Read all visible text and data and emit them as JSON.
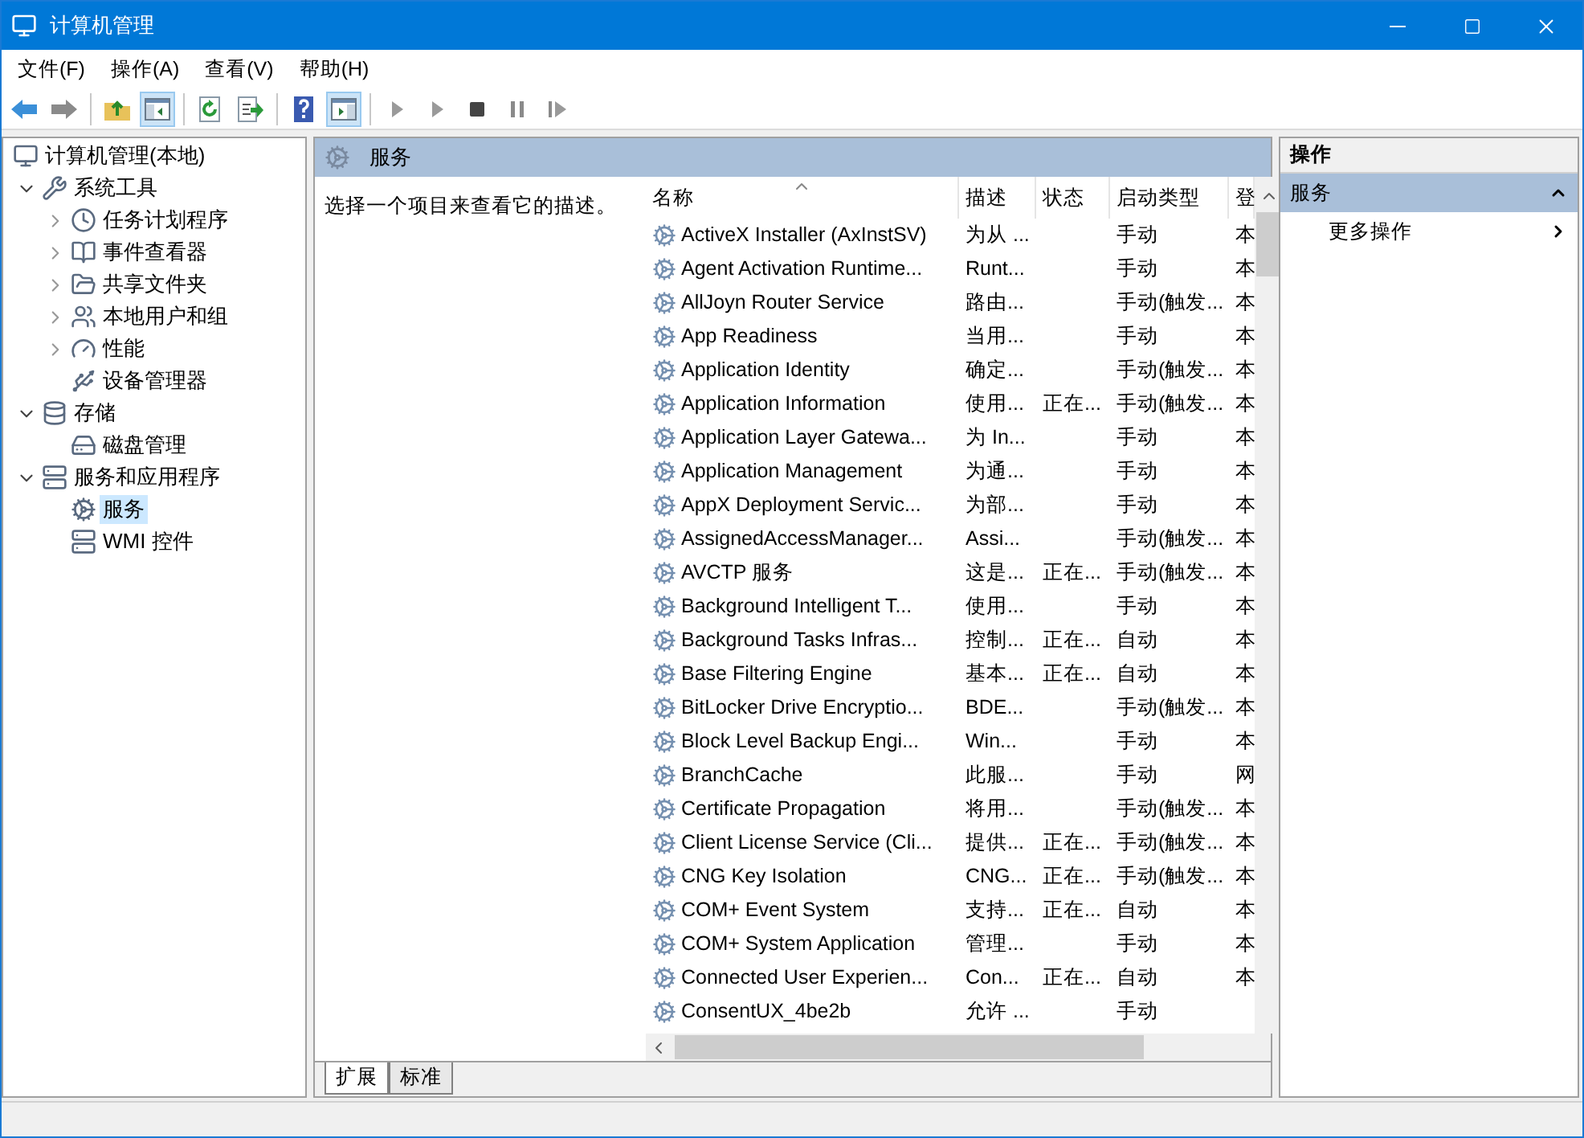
{
  "window": {
    "title": "计算机管理"
  },
  "menu": [
    "文件(F)",
    "操作(A)",
    "查看(V)",
    "帮助(H)"
  ],
  "toolbar": [
    {
      "kind": "back",
      "pressed": false
    },
    {
      "kind": "forward",
      "pressed": false
    },
    {
      "kind": "separator"
    },
    {
      "kind": "up",
      "pressed": false
    },
    {
      "kind": "tree-pane",
      "pressed": true
    },
    {
      "kind": "separator"
    },
    {
      "kind": "refresh",
      "pressed": false
    },
    {
      "kind": "export",
      "pressed": false
    },
    {
      "kind": "separator"
    },
    {
      "kind": "help",
      "pressed": false
    },
    {
      "kind": "action-pane",
      "pressed": true
    },
    {
      "kind": "separator"
    },
    {
      "kind": "play",
      "pressed": false
    },
    {
      "kind": "play",
      "pressed": false
    },
    {
      "kind": "stop",
      "pressed": false
    },
    {
      "kind": "pause",
      "pressed": false
    },
    {
      "kind": "resume",
      "pressed": false
    }
  ],
  "tree": [
    {
      "label": "计算机管理(本地)",
      "selected": false,
      "children": [
        {
          "label": "系统工具",
          "selected": false,
          "expanded": true,
          "children": [
            {
              "label": "任务计划程序",
              "selected": false,
              "expanded": false
            },
            {
              "label": "事件查看器",
              "selected": false,
              "expanded": false
            },
            {
              "label": "共享文件夹",
              "selected": false,
              "expanded": false
            },
            {
              "label": "本地用户和组",
              "selected": false,
              "expanded": false
            },
            {
              "label": "性能",
              "selected": false,
              "expanded": false
            },
            {
              "label": "设备管理器",
              "selected": false
            }
          ]
        },
        {
          "label": "存储",
          "selected": false,
          "expanded": true,
          "children": [
            {
              "label": "磁盘管理",
              "selected": false
            }
          ]
        },
        {
          "label": "服务和应用程序",
          "selected": false,
          "expanded": true,
          "children": [
            {
              "label": "服务",
              "selected": true
            },
            {
              "label": "WMI 控件",
              "selected": false
            }
          ]
        }
      ]
    }
  ],
  "content": {
    "header": "服务",
    "description": "选择一个项目来查看它的描述。",
    "columns": [
      {
        "label": "名称",
        "sorted": true
      },
      {
        "label": "描述",
        "sorted": false
      },
      {
        "label": "状态",
        "sorted": false
      },
      {
        "label": "启动类型",
        "sorted": false
      },
      {
        "label": "登",
        "sorted": false
      }
    ],
    "rows": [
      {
        "name": "ActiveX Installer (AxInstSV)",
        "description": "为从 ...",
        "startup": "手动",
        "column_5": "本"
      },
      {
        "name": "Agent Activation Runtime...",
        "description": "Runt...",
        "startup": "手动",
        "column_5": "本"
      },
      {
        "name": "AllJoyn Router Service",
        "description": "路由...",
        "startup": "手动(触发...",
        "column_5": "本"
      },
      {
        "name": "App Readiness",
        "description": "当用...",
        "startup": "手动",
        "column_5": "本"
      },
      {
        "name": "Application Identity",
        "description": "确定...",
        "startup": "手动(触发...",
        "column_5": "本"
      },
      {
        "name": "Application Information",
        "description": "使用...",
        "status": "正在...",
        "startup": "手动(触发...",
        "column_5": "本"
      },
      {
        "name": "Application Layer Gatewa...",
        "description": "为 In...",
        "startup": "手动",
        "column_5": "本"
      },
      {
        "name": "Application Management",
        "description": "为通...",
        "startup": "手动",
        "column_5": "本"
      },
      {
        "name": "AppX Deployment Servic...",
        "description": "为部...",
        "startup": "手动",
        "column_5": "本"
      },
      {
        "name": "AssignedAccessManager...",
        "description": "Assi...",
        "startup": "手动(触发...",
        "column_5": "本"
      },
      {
        "name": "AVCTP 服务",
        "description": "这是...",
        "status": "正在...",
        "startup": "手动(触发...",
        "column_5": "本"
      },
      {
        "name": "Background Intelligent T...",
        "description": "使用...",
        "startup": "手动",
        "column_5": "本"
      },
      {
        "name": "Background Tasks Infras...",
        "description": "控制...",
        "status": "正在...",
        "startup": "自动",
        "column_5": "本"
      },
      {
        "name": "Base Filtering Engine",
        "description": "基本...",
        "status": "正在...",
        "startup": "自动",
        "column_5": "本"
      },
      {
        "name": "BitLocker Drive Encryptio...",
        "description": "BDE...",
        "startup": "手动(触发...",
        "column_5": "本"
      },
      {
        "name": "Block Level Backup Engi...",
        "description": "Win...",
        "startup": "手动",
        "column_5": "本"
      },
      {
        "name": "BranchCache",
        "description": "此服...",
        "startup": "手动",
        "column_5": "网"
      },
      {
        "name": "Certificate Propagation",
        "description": "将用...",
        "startup": "手动(触发...",
        "column_5": "本"
      },
      {
        "name": "Client License Service (Cli...",
        "description": "提供...",
        "status": "正在...",
        "startup": "手动(触发...",
        "column_5": "本"
      },
      {
        "name": "CNG Key Isolation",
        "description": "CNG...",
        "status": "正在...",
        "startup": "手动(触发...",
        "column_5": "本"
      },
      {
        "name": "COM+ Event System",
        "description": "支持...",
        "status": "正在...",
        "startup": "自动",
        "column_5": "本"
      },
      {
        "name": "COM+ System Application",
        "description": "管理...",
        "startup": "手动",
        "column_5": "本"
      },
      {
        "name": "Connected User Experien...",
        "description": "Con...",
        "status": "正在...",
        "startup": "自动",
        "column_5": "本"
      },
      {
        "name": "ConsentUX_4be2b",
        "description": "允许 ...",
        "startup": "手动"
      }
    ]
  },
  "tabs": [
    {
      "label": "扩展",
      "selected": true
    },
    {
      "label": "标准",
      "selected": false
    }
  ],
  "actions": {
    "title": "操作",
    "section": "服务",
    "items": [
      "更多操作"
    ]
  }
}
